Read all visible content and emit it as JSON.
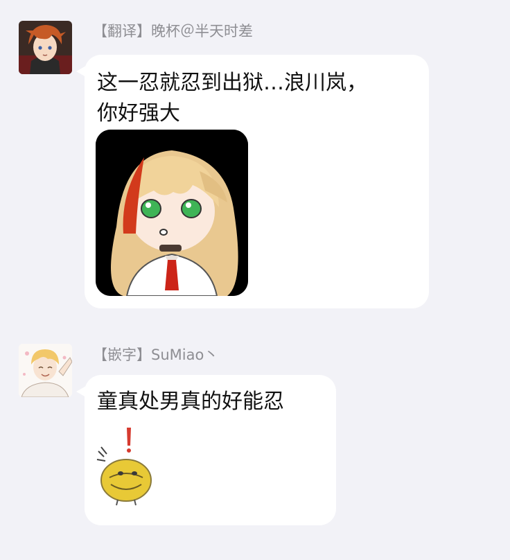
{
  "messages": [
    {
      "sender": "【翻译】晚杯＠半天时差",
      "text_line1": "这一忍就忍到出狱…浪川岚，",
      "text_line2": "你好强大"
    },
    {
      "sender": "【嵌字】SuMiao丶",
      "text": "童真处男真的好能忍"
    }
  ],
  "colors": {
    "background": "#f2f2f7",
    "bubble": "#ffffff",
    "sender_text": "#8e8e93",
    "message_text": "#111111"
  }
}
